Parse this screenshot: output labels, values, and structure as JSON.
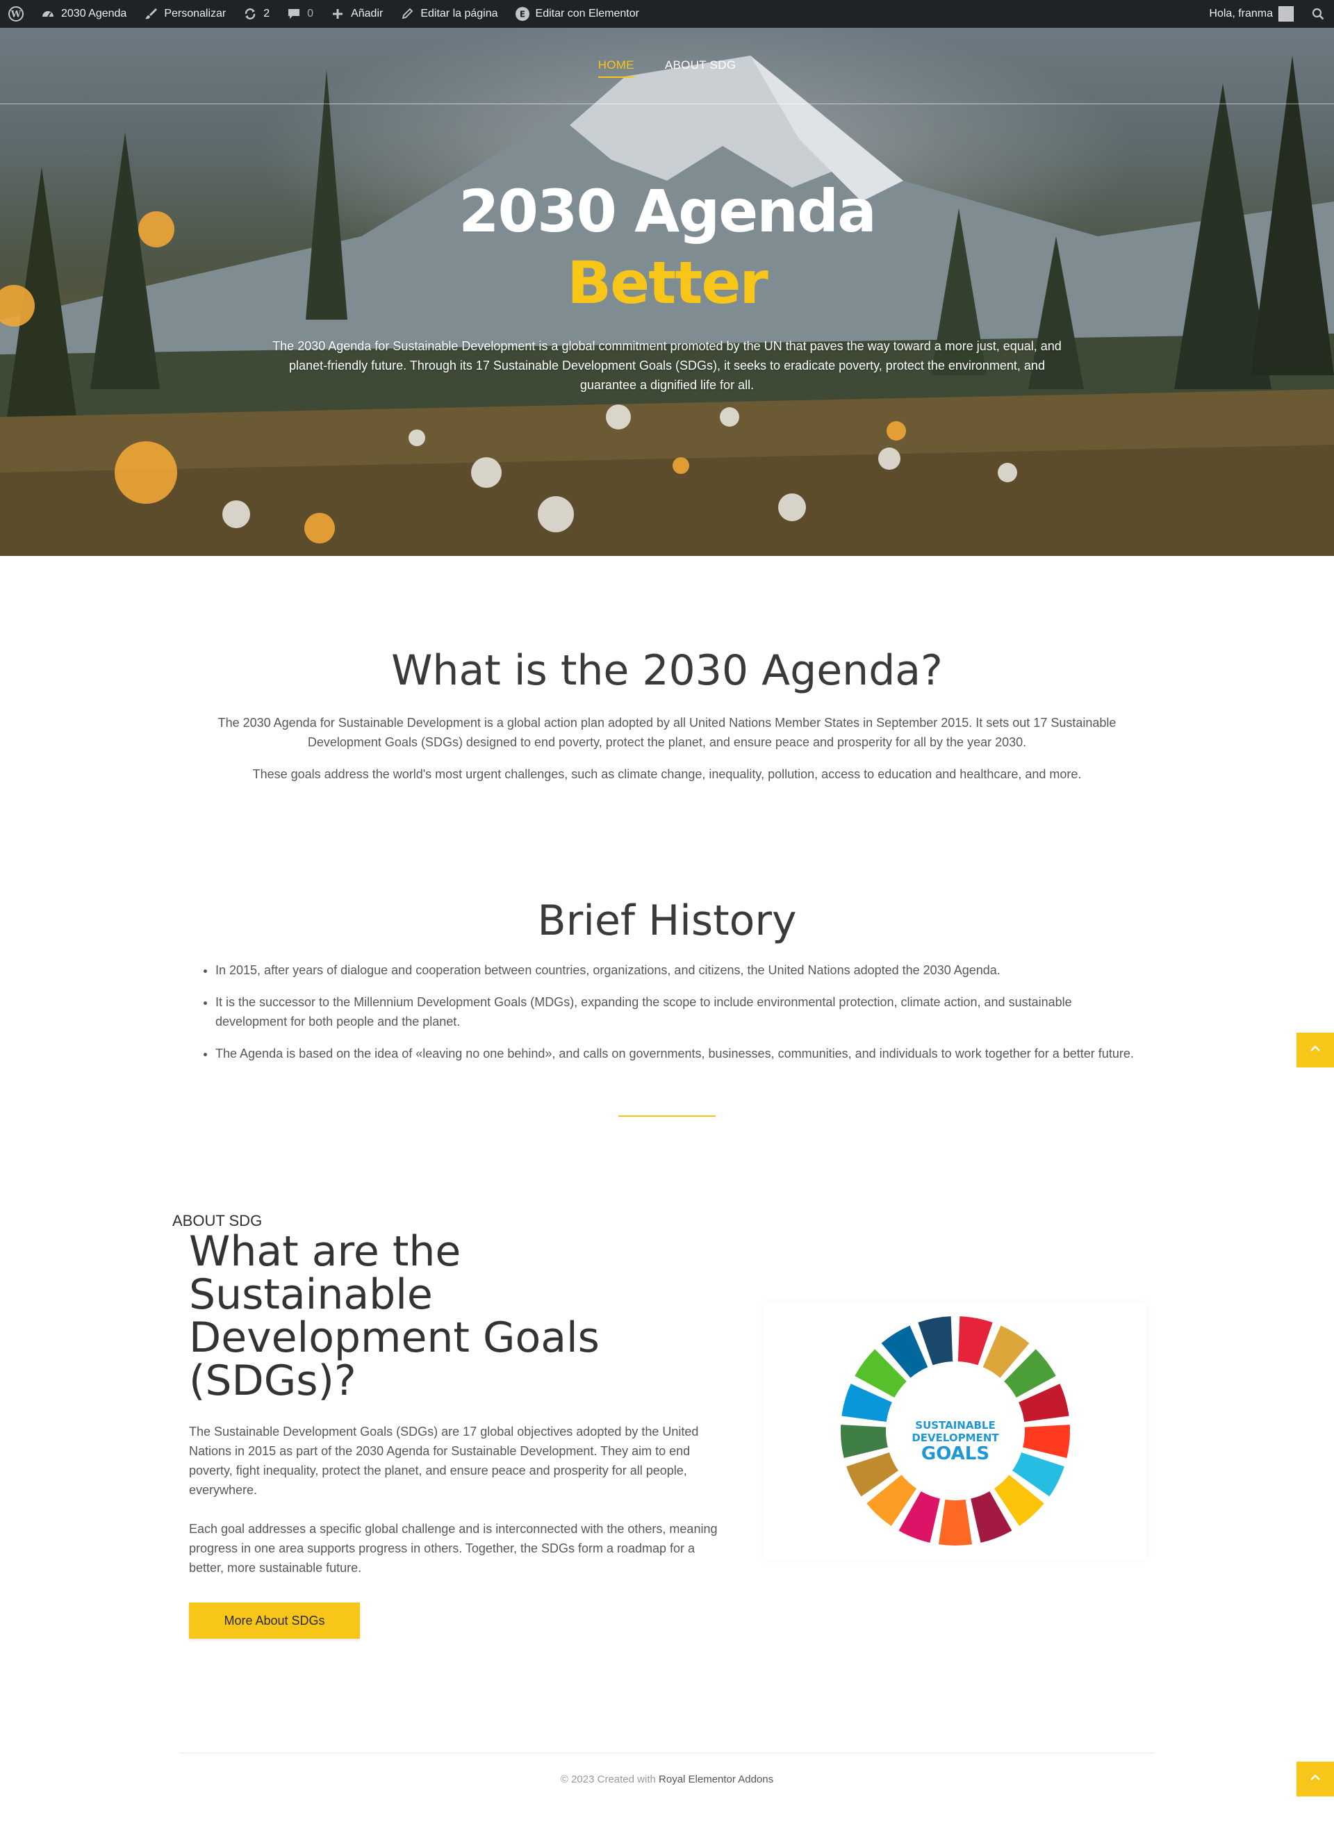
{
  "adminbar": {
    "site_name": "2030 Agenda",
    "customize": "Personalizar",
    "updates_count": "2",
    "comments_count": "0",
    "add_new": "Añadir",
    "edit_page": "Editar la página",
    "edit_elementor": "Editar con Elementor",
    "greeting": "Hola, franma",
    "elementor_badge": "E"
  },
  "nav": {
    "home": "HOME",
    "about": "ABOUT SDG"
  },
  "hero": {
    "title_line1": "2030 Agenda",
    "title_line2": "Better",
    "description": "The 2030 Agenda for Sustainable Development is a global commitment promoted by the UN that paves the way toward a more just, equal, and planet-friendly future. Through its 17 Sustainable Development Goals (SDGs), it seeks to eradicate poverty, protect the environment, and guarantee a dignified life for all."
  },
  "what_is": {
    "title": "What is the 2030 Agenda?",
    "para1": "The 2030 Agenda for Sustainable Development is a global action plan adopted by all United Nations Member States in September 2015. It sets out 17 Sustainable Development Goals (SDGs) designed to end poverty, protect the planet, and ensure peace and prosperity for all by the year 2030.",
    "para2": "These goals address the world's most urgent challenges, such as climate change, inequality, pollution, access to education and healthcare, and more."
  },
  "history": {
    "title": "Brief History",
    "items": [
      "In 2015, after years of dialogue and cooperation between countries, organizations, and citizens, the United Nations adopted the 2030 Agenda.",
      "It is the successor to the Millennium Development Goals (MDGs), expanding the scope to include environmental protection, climate action, and sustainable development for both people and the planet.",
      "The Agenda is based on the idea of «leaving no one behind», and calls on governments, businesses, communities, and individuals to work together for a better future."
    ]
  },
  "about": {
    "tag": "ABOUT SDG",
    "title": "What are the Sustainable Development Goals (SDGs)?",
    "para1": "The Sustainable Development Goals (SDGs) are 17 global objectives adopted by the United Nations in 2015 as part of the 2030 Agenda for Sustainable Development. They aim to end poverty, fight inequality, protect the planet, and ensure peace and prosperity for all people, everywhere.",
    "para2": "Each goal addresses a specific global challenge and is interconnected with the others, meaning progress in one area supports progress in others. Together, the SDGs form a roadmap for a better, more sustainable future.",
    "button": "More About SDGs"
  },
  "sdg_logo": {
    "line1": "SUSTAINABLE",
    "line2": "DEVELOPMENT",
    "line3": "GOALS",
    "colors": [
      "#E5243B",
      "#DDA63A",
      "#4C9F38",
      "#C5192D",
      "#FF3A21",
      "#26BDE2",
      "#FCC30B",
      "#A21942",
      "#FD6925",
      "#DD1367",
      "#FD9D24",
      "#BF8B2E",
      "#3F7E44",
      "#0A97D9",
      "#56C02B",
      "#00689D",
      "#19486A"
    ]
  },
  "footer": {
    "prefix": "© 2023 Created with ",
    "brand": "Royal Elementor Addons"
  },
  "icons": [
    "wordpress-icon",
    "dashboard-icon",
    "brush-icon",
    "update-icon",
    "comment-icon",
    "plus-icon",
    "pencil-icon",
    "elementor-icon",
    "avatar",
    "search-icon",
    "chevron-up-icon"
  ],
  "accent": "#F7C618"
}
